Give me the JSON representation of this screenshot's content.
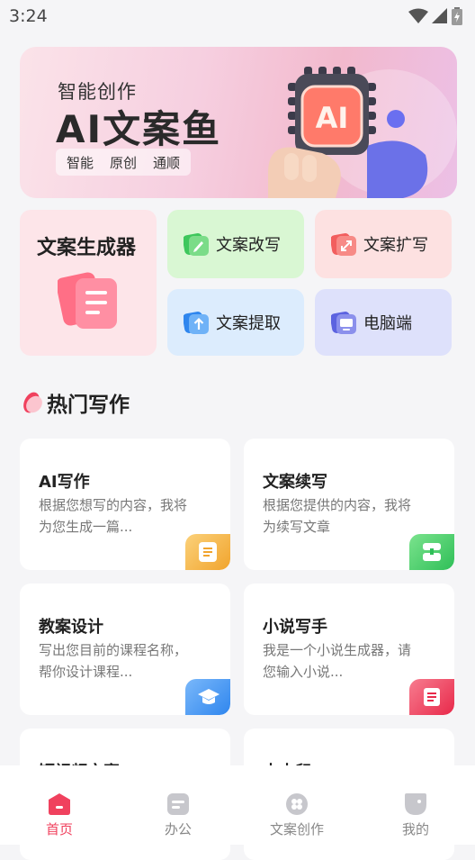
{
  "status": {
    "time": "3:24"
  },
  "banner": {
    "subtitle": "智能创作",
    "title": "AI文案鱼",
    "tags": [
      "智能",
      "原创",
      "通顺"
    ],
    "art_text": "AI"
  },
  "tools": {
    "generator": "文案生成器",
    "rewrite": "文案改写",
    "expand": "文案扩写",
    "extract": "文案提取",
    "desktop": "电脑端"
  },
  "section": {
    "title": "热门写作"
  },
  "cards": [
    {
      "title": "AI写作",
      "desc": "根据您想写的内容，我将为您生成一篇...",
      "badge_color": "#f5b53a",
      "icon": "document-icon"
    },
    {
      "title": "文案续写",
      "desc": "根据您提供的内容，我将为续写文章",
      "badge_color": "#3fcf6a",
      "icon": "continue-icon"
    },
    {
      "title": "教案设计",
      "desc": "写出您目前的课程名称，帮你设计课程...",
      "badge_color": "#3b8ff0",
      "icon": "graduation-cap-icon"
    },
    {
      "title": "小说写手",
      "desc": "我是一个小说生成器，请您输入小说...",
      "badge_color": "#f0415e",
      "icon": "book-icon"
    },
    {
      "title": "短视频文案",
      "desc": "",
      "badge_color": "#f5b53a",
      "icon": "video-icon"
    },
    {
      "title": "去水印",
      "desc": "",
      "badge_color": "#3b8ff0",
      "icon": "watermark-icon"
    }
  ],
  "tabs": [
    {
      "label": "首页",
      "icon": "home-icon",
      "active": true
    },
    {
      "label": "办公",
      "icon": "office-icon",
      "active": false
    },
    {
      "label": "文案创作",
      "icon": "creation-icon",
      "active": false
    },
    {
      "label": "我的",
      "icon": "profile-icon",
      "active": false
    }
  ],
  "colors": {
    "accent": "#f0415e",
    "background": "#f5f5f7"
  }
}
